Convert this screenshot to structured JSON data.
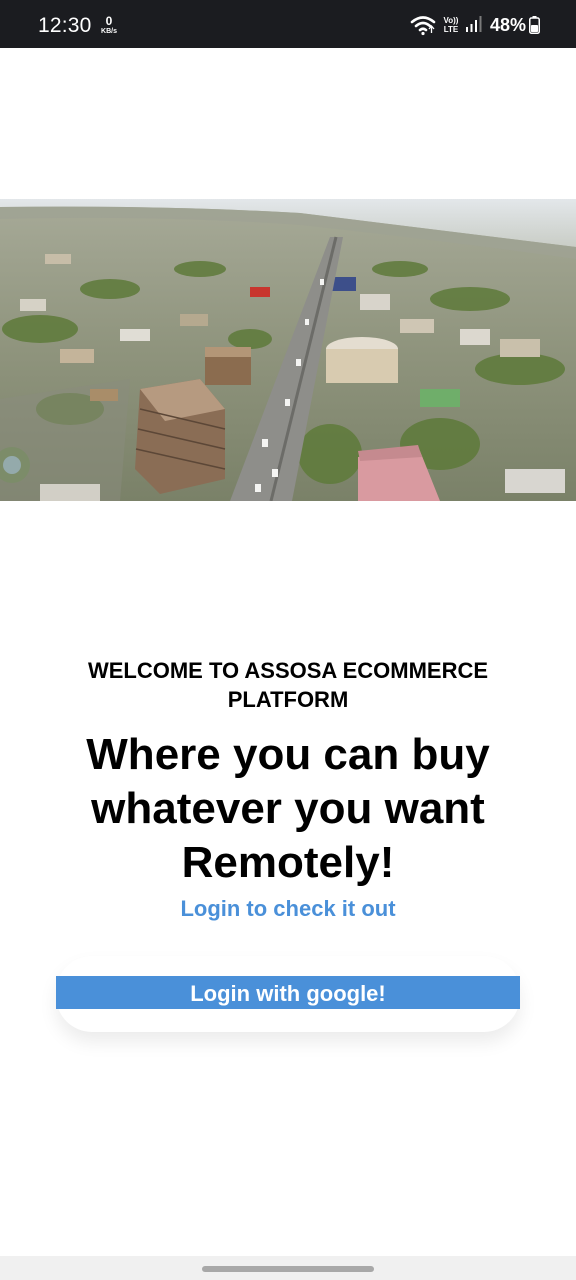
{
  "status_bar": {
    "time": "12:30",
    "net_speed_value": "0",
    "net_speed_unit": "KB/s",
    "volte_line1": "Vo))",
    "volte_line2": "LTE",
    "battery_text": "48%",
    "icons": [
      "wifi-icon",
      "signal-icon",
      "battery-icon"
    ]
  },
  "hero": {
    "image": "aerial-city-photo",
    "colors": {
      "sky": "#d9dfe3",
      "ground": "#9aa08c",
      "trees": "#5e7a3a",
      "road": "#8e8e8e"
    }
  },
  "content": {
    "welcome": "WELCOME TO ASSOSA ECOMMERCE PLATFORM",
    "headline": "Where you can buy whatever you want Remotely!",
    "subline": "Login to check it out"
  },
  "login": {
    "google_label": "Login with google!"
  },
  "colors": {
    "accent": "#4a90d9",
    "status_bar": "#1b1c20",
    "text": "#000000"
  }
}
